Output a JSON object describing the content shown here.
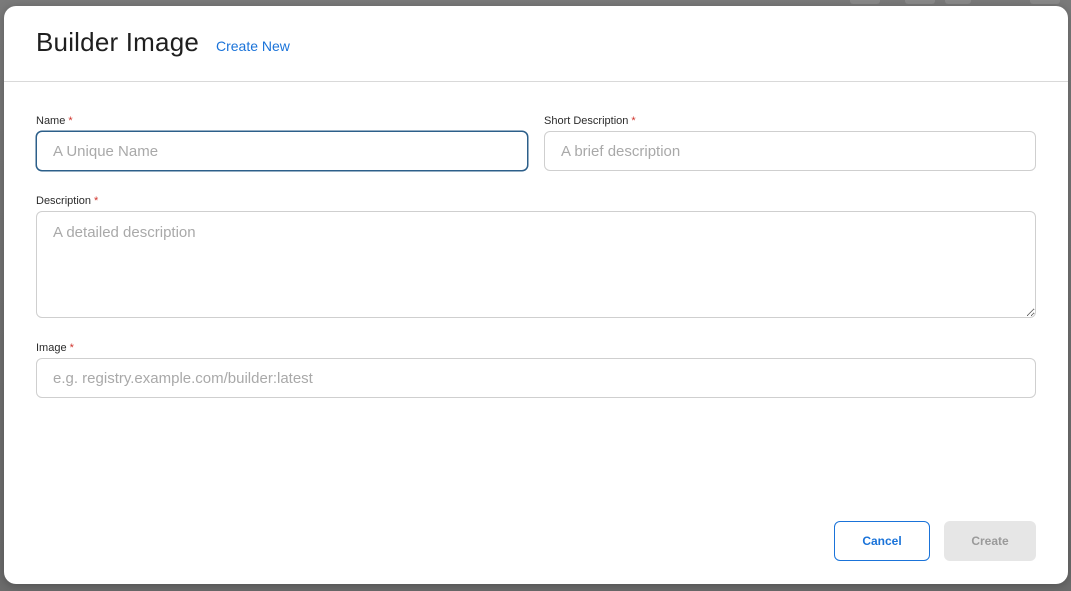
{
  "dialog": {
    "title": "Builder Image",
    "create_new_label": "Create New"
  },
  "form": {
    "required_marker": "*",
    "name": {
      "label": "Name",
      "value": "",
      "placeholder": "A Unique Name"
    },
    "short_description": {
      "label": "Short Description",
      "value": "",
      "placeholder": "A brief description"
    },
    "description": {
      "label": "Description",
      "value": "",
      "placeholder": "A detailed description"
    },
    "image": {
      "label": "Image",
      "value": "",
      "placeholder": "e.g. registry.example.com/builder:latest"
    }
  },
  "actions": {
    "cancel_label": "Cancel",
    "create_label": "Create"
  },
  "colors": {
    "accent": "#1a73d9",
    "required": "#d0342c",
    "focus_border": "#2c5f8a",
    "disabled_bg": "#e6e6e6"
  }
}
